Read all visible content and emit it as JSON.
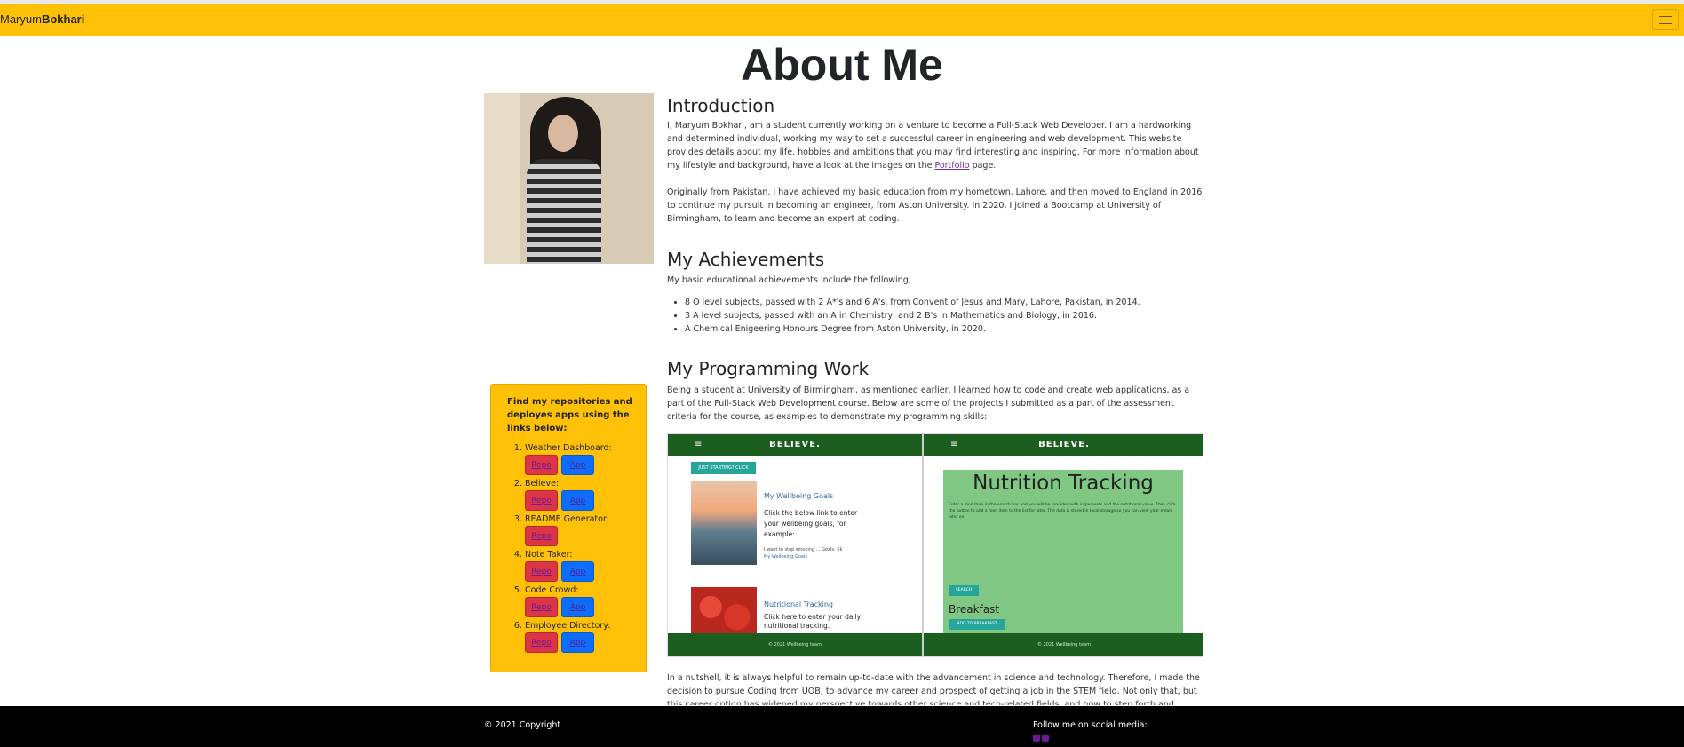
{
  "navbar": {
    "brand_first": "Maryum",
    "brand_last": "Bokhari",
    "accent_color": "#ffc107",
    "toggler_icon": "hamburger-menu-icon"
  },
  "page": {
    "title": "About Me"
  },
  "introduction": {
    "heading": "Introduction",
    "p1_before_link": "I, Maryum Bokhari, am a student currently working on a venture to become a Full-Stack Web Developer. I am a hardworking and determined individual, working my way to set a successful career in engineering and web development. This website provides details about my life, hobbies and ambitions that you may find interesting and inspiring. For more information about my lifestyle and background, have a look at the images on the ",
    "p1_link": "Portfolio",
    "p1_after_link": " page.",
    "p2": "Originally from Pakistan, I have achieved my basic education from my hometown, Lahore, and then moved to England in 2016 to continue my pursuit in becoming an engineer, from Aston University. In 2020, I joined a Bootcamp at University of Birmingham, to learn and become an expert at coding."
  },
  "achievements": {
    "heading": "My Achievements",
    "intro": "My basic educational achievements include the following;",
    "items": [
      "8 O level subjects, passed with 2 A*'s and 6 A's, from Convent of Jesus and Mary, Lahore, Pakistan, in 2014.",
      "3 A level subjects, passed with an A in Chemistry, and 2 B's in Mathematics and Biology, in 2016.",
      "A Chemical Enigeering Honours Degree from Aston University, in 2020."
    ]
  },
  "programming": {
    "heading": "My Programming Work",
    "intro": "Being a student at University of Birmingham, as mentioned earlier, I learned how to code and create web applications, as a part of the Full-Stack Web Development course. Below are some of the projects I submitted as a part of the assessment criteria for the course, as examples to demonstrate my programming skills:",
    "outro": "In a nutshell, it is always helpful to remain up-to-date with the advancement in science and technology. Therefore, I made the decision to pursue Coding from UOB, to advance my career and prospect of getting a job in the STEM field. Not only that, but this career option has widened my perspective towards other science and tech-related fields, and how to step forth and develop one's own platform, for the"
  },
  "screenshot": {
    "brand_left": "BELIEVE.",
    "brand_right": "BELIEVE.",
    "start_button": "JUST STARTING? CLICK",
    "goals_heading": "My Wellbeing Goals",
    "goals_text": "Click the below link to enter your wellbeing goals, for example:",
    "goals_sub": "I want to stop smoking ... Goals: 5k",
    "goals_link": "My Wellbeing Goals",
    "nutrition_link_heading": "Nutritional Tracking",
    "nutrition_text": "Click here to enter your daily nutritional tracking.",
    "nutrition_title": "Nutrition Tracking",
    "nutrition_para": "Enter a food item in the search bar and you will be provided with ingredients and the nutritional value. Then click the button to add a food item to the list for later. The data is stored in local storage so you can view your meals later on.",
    "search_button": "SEARCH",
    "breakfast": "Breakfast",
    "add_breakfast": "ADD TO BREAKFAST",
    "footer_left": "© 2021 Wellbeing team",
    "footer_right": "© 2021 Wellbeing team"
  },
  "sidebar": {
    "title": "Find my repositories and deployes apps using the links below:",
    "repo_label": "Repo",
    "app_label": "App",
    "projects": [
      {
        "name": "Weather Dashboard:",
        "has_app": true
      },
      {
        "name": "Believe:",
        "has_app": true
      },
      {
        "name": "README Generator:",
        "has_app": false
      },
      {
        "name": "Note Taker:",
        "has_app": true
      },
      {
        "name": "Code Crowd:",
        "has_app": true
      },
      {
        "name": "Employee Directory:",
        "has_app": true
      }
    ]
  },
  "footer": {
    "copyright": "© 2021 Copyright",
    "follow": "Follow me on social media:",
    "social_icons": [
      "instagram-icon",
      "github-icon"
    ]
  }
}
